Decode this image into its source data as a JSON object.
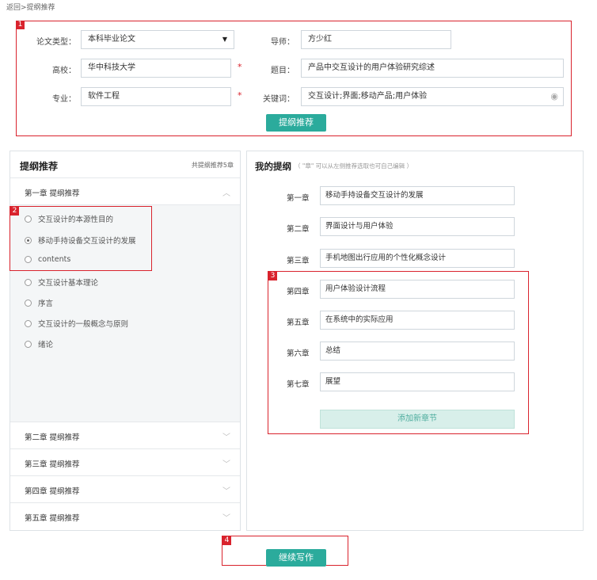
{
  "breadcrumb": "返回>提纲推荐",
  "annotations": [
    "1",
    "2",
    "3",
    "4"
  ],
  "form": {
    "paper_type_label": "论文类型：",
    "paper_type_value": "本科毕业论文",
    "school_label": "高校：",
    "school_value": "华中科技大学",
    "major_label": "专业：",
    "major_value": "软件工程",
    "advisor_label": "导师：",
    "advisor_value": "方少红",
    "topic_label": "题目：",
    "topic_value": "产品中交互设计的用户体验研究综述",
    "keywords_label": "关键词：",
    "keywords_value": "交互设计;界面;移动产品;用户体验",
    "required_mark": "*",
    "submit_label": "提纲推荐"
  },
  "left_panel": {
    "title": "提纲推荐",
    "count": "共提纲推荐5章",
    "expanded_chapter": "第一章  提纲推荐",
    "options": [
      {
        "label": "交互设计的本源性目的",
        "selected": false
      },
      {
        "label": "移动手持设备交互设计的发展",
        "selected": true
      },
      {
        "label": "contents",
        "selected": false
      },
      {
        "label": "交互设计基本理论",
        "selected": false
      },
      {
        "label": "序言",
        "selected": false
      },
      {
        "label": "交互设计的一般概念与原则",
        "selected": false
      },
      {
        "label": "绪论",
        "selected": false
      }
    ],
    "collapsed_chapters": [
      "第二章  提纲推荐",
      "第三章  提纲推荐",
      "第四章  提纲推荐",
      "第五章  提纲推荐"
    ]
  },
  "right_panel": {
    "title": "我的提纲",
    "subtitle": "（ \"章\" 可以从左侧推荐选取也可自己编辑 ）",
    "chapters": [
      {
        "label": "第一章",
        "value": "移动手持设备交互设计的发展"
      },
      {
        "label": "第二章",
        "value": "界面设计与用户体验"
      },
      {
        "label": "第三章",
        "value": "手机地图出行应用的个性化概念设计"
      },
      {
        "label": "第四章",
        "value": "用户体验设计流程"
      },
      {
        "label": "第五章",
        "value": "在系统中的实际应用"
      },
      {
        "label": "第六章",
        "value": "总结"
      },
      {
        "label": "第七章",
        "value": "展望"
      }
    ],
    "add_label": "添加新章节"
  },
  "continue_label": "继续写作",
  "colors": {
    "accent": "#2bab9c",
    "annotation_red": "#d9232d"
  }
}
